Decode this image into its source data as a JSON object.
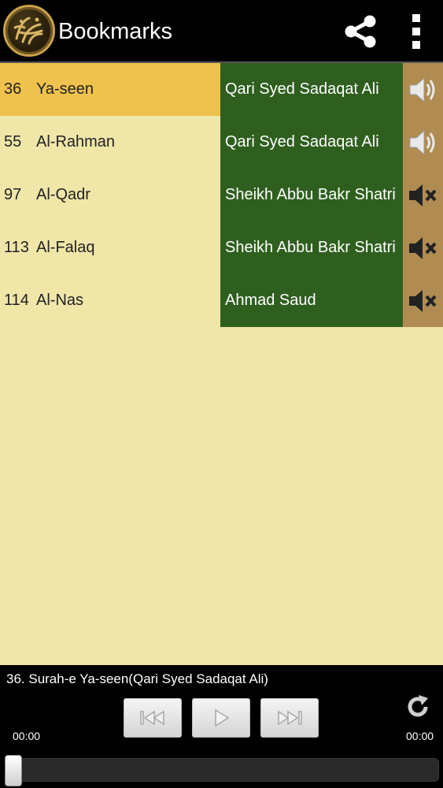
{
  "action_bar": {
    "title": "Bookmarks",
    "icons": {
      "logo": "quran-logo-icon",
      "share": "share-icon",
      "overflow": "overflow-menu-icon"
    }
  },
  "bookmarks": [
    {
      "number": "36",
      "surah": "Ya-seen",
      "reciter": "Qari Syed Sadaqat Ali",
      "audio": "speaker-on-icon",
      "selected": true
    },
    {
      "number": "55",
      "surah": "Al-Rahman",
      "reciter": "Qari Syed Sadaqat Ali",
      "audio": "speaker-on-icon",
      "selected": false
    },
    {
      "number": "97",
      "surah": "Al-Qadr",
      "reciter": "Sheikh Abbu Bakr Shatri",
      "audio": "speaker-muted-icon",
      "selected": false
    },
    {
      "number": "113",
      "surah": "Al-Falaq",
      "reciter": "Sheikh Abbu Bakr Shatri",
      "audio": "speaker-muted-icon",
      "selected": false
    },
    {
      "number": "114",
      "surah": "Al-Nas",
      "reciter": "Ahmad Saud",
      "audio": "speaker-muted-icon",
      "selected": false
    }
  ],
  "player": {
    "now_playing": "36. Surah-e Ya-seen(Qari Syed Sadaqat Ali)",
    "elapsed": "00:00",
    "duration": "00:00",
    "progress": 0,
    "icons": {
      "previous": "skip-previous-icon",
      "play": "play-icon",
      "next": "skip-next-icon",
      "repeat": "refresh-icon"
    }
  },
  "colors": {
    "surah_cell": "#efe6a8",
    "surah_cell_selected": "#efc24d",
    "reciter_cell": "#2f5f1f",
    "audio_cell": "#b08c52",
    "list_background": "#eee7a9"
  }
}
